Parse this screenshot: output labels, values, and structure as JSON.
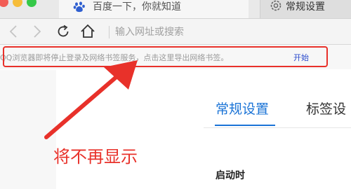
{
  "window": {
    "tab_title": "百度一下，你就知道",
    "tab_icon": "baidu-paw-icon",
    "settings_tab_title": "常规设置",
    "settings_tab_icon": "gear-icon"
  },
  "toolbar": {
    "back_icon": "chevron-left-icon",
    "forward_icon": "chevron-right-icon",
    "reload_icon": "reload-icon",
    "home_icon": "home-icon",
    "address_placeholder": "输入网址或搜索"
  },
  "notice": {
    "message": "QQ浏览器即将停止登录及网络书签服务，点击这里导出网络书签。",
    "link": "开始"
  },
  "settings": {
    "tab_general": "常规设置",
    "tab_bookmarks": "标签设",
    "startup_label": "启动时"
  },
  "annotation": {
    "text": "将不再显示",
    "color": "#e8312a"
  }
}
